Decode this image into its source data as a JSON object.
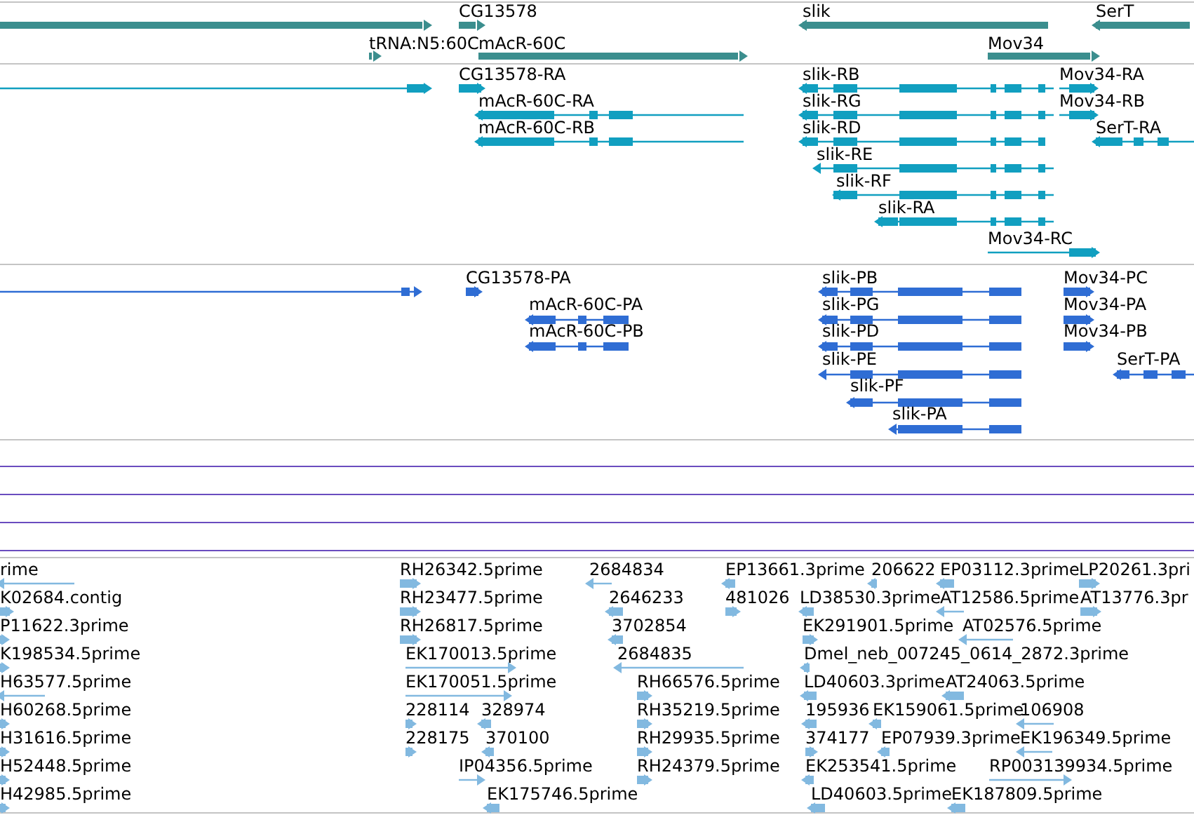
{
  "tracks": [
    {
      "kind": "gene",
      "features": [
        {
          "label": "CG13578"
        },
        {
          "label": "slik"
        },
        {
          "label": "SerT"
        },
        {
          "label": "tRNA:N5:60C"
        },
        {
          "label": "mAcR-60C"
        },
        {
          "label": "Mov34"
        }
      ]
    },
    {
      "kind": "transcript",
      "features": [
        {
          "label": "CG13578-RA"
        },
        {
          "label": "mAcR-60C-RA"
        },
        {
          "label": "mAcR-60C-RB"
        },
        {
          "label": "slik-RB"
        },
        {
          "label": "slik-RG"
        },
        {
          "label": "slik-RD"
        },
        {
          "label": "slik-RE"
        },
        {
          "label": "slik-RF"
        },
        {
          "label": "slik-RA"
        },
        {
          "label": "Mov34-RA"
        },
        {
          "label": "Mov34-RB"
        },
        {
          "label": "SerT-RA"
        },
        {
          "label": "Mov34-RC"
        }
      ]
    },
    {
      "kind": "protein",
      "features": [
        {
          "label": "CG13578-PA"
        },
        {
          "label": "mAcR-60C-PA"
        },
        {
          "label": "mAcR-60C-PB"
        },
        {
          "label": "slik-PB"
        },
        {
          "label": "slik-PG"
        },
        {
          "label": "slik-PD"
        },
        {
          "label": "slik-PE"
        },
        {
          "label": "slik-PF"
        },
        {
          "label": "slik-PA"
        },
        {
          "label": "Mov34-PC"
        },
        {
          "label": "Mov34-PA"
        },
        {
          "label": "Mov34-PB"
        },
        {
          "label": "SerT-PA"
        }
      ]
    },
    {
      "kind": "blank"
    },
    {
      "kind": "blank"
    },
    {
      "kind": "blank"
    },
    {
      "kind": "blank"
    },
    {
      "kind": "est",
      "features": [
        {
          "label": "rime"
        },
        {
          "label": "RH26342.5prime"
        },
        {
          "label": "2684834"
        },
        {
          "label": "EP13661.3prime"
        },
        {
          "label": "206622"
        },
        {
          "label": "EP03112.3prime"
        },
        {
          "label": "LP20261.3pri"
        },
        {
          "label": "K02684.contig"
        },
        {
          "label": "RH23477.5prime"
        },
        {
          "label": "2646233"
        },
        {
          "label": "481026"
        },
        {
          "label": "LD38530.3prime"
        },
        {
          "label": "AT12586.5prime"
        },
        {
          "label": "AT13776.3pr"
        },
        {
          "label": "P11622.3prime"
        },
        {
          "label": "RH26817.5prime"
        },
        {
          "label": "3702854"
        },
        {
          "label": "EK291901.5prime"
        },
        {
          "label": "AT02576.5prime"
        },
        {
          "label": "K198534.5prime"
        },
        {
          "label": "EK170013.5prime"
        },
        {
          "label": "2684835"
        },
        {
          "label": "Dmel_neb_007245_0614_2872.3prime"
        },
        {
          "label": "H63577.5prime"
        },
        {
          "label": "EK170051.5prime"
        },
        {
          "label": "RH66576.5prime"
        },
        {
          "label": "LD40603.3prime"
        },
        {
          "label": "AT24063.5prime"
        },
        {
          "label": "H60268.5prime"
        },
        {
          "label": "228114"
        },
        {
          "label": "328974"
        },
        {
          "label": "RH35219.5prime"
        },
        {
          "label": "195936"
        },
        {
          "label": "EK159061.5prime"
        },
        {
          "label": "106908"
        },
        {
          "label": "H31616.5prime"
        },
        {
          "label": "228175"
        },
        {
          "label": "370100"
        },
        {
          "label": "RH29935.5prime"
        },
        {
          "label": "374177"
        },
        {
          "label": "EP07939.3prime"
        },
        {
          "label": "EK196349.5prime"
        },
        {
          "label": "H52448.5prime"
        },
        {
          "label": "IP04356.5prime"
        },
        {
          "label": "RH24379.5prime"
        },
        {
          "label": "EK253541.5prime"
        },
        {
          "label": "RP003139934.5prime"
        },
        {
          "label": "H42985.5prime"
        },
        {
          "label": "EK175746.5prime"
        },
        {
          "label": "LD40603.5prime"
        },
        {
          "label": "EK187809.5prime"
        }
      ]
    }
  ]
}
